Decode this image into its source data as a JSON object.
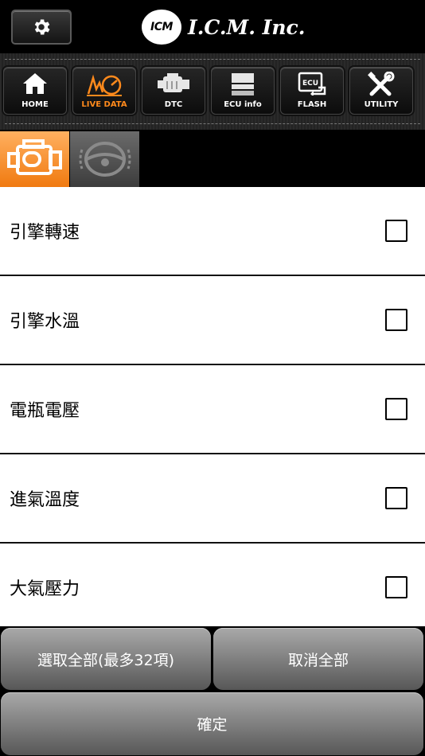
{
  "header": {
    "settings_icon": "gear-icon",
    "logo_badge": "ICM",
    "logo_text": "I.C.M. Inc."
  },
  "nav": {
    "items": [
      {
        "label": "HOME",
        "icon": "home-icon",
        "active": false
      },
      {
        "label": "LIVE DATA",
        "icon": "live-data-icon",
        "active": true
      },
      {
        "label": "DTC",
        "icon": "engine-icon",
        "active": false
      },
      {
        "label": "ECU info",
        "icon": "ecu-info-icon",
        "active": false
      },
      {
        "label": "FLASH",
        "icon": "flash-icon",
        "active": false
      },
      {
        "label": "UTILITY",
        "icon": "utility-icon",
        "active": false
      }
    ],
    "active_color": "#ff8a1c"
  },
  "subtabs": [
    {
      "icon": "engine-icon",
      "selected": true
    },
    {
      "icon": "steering-wheel-icon",
      "selected": false
    }
  ],
  "list": {
    "items": [
      {
        "label": "引擎轉速",
        "checked": false
      },
      {
        "label": "引擎水溫",
        "checked": false
      },
      {
        "label": "電瓶電壓",
        "checked": false
      },
      {
        "label": "進氣溫度",
        "checked": false
      },
      {
        "label": "大氣壓力",
        "checked": false
      }
    ]
  },
  "buttons": {
    "select_all": "選取全部(最多32項)",
    "cancel_all": "取消全部",
    "confirm": "確定"
  }
}
